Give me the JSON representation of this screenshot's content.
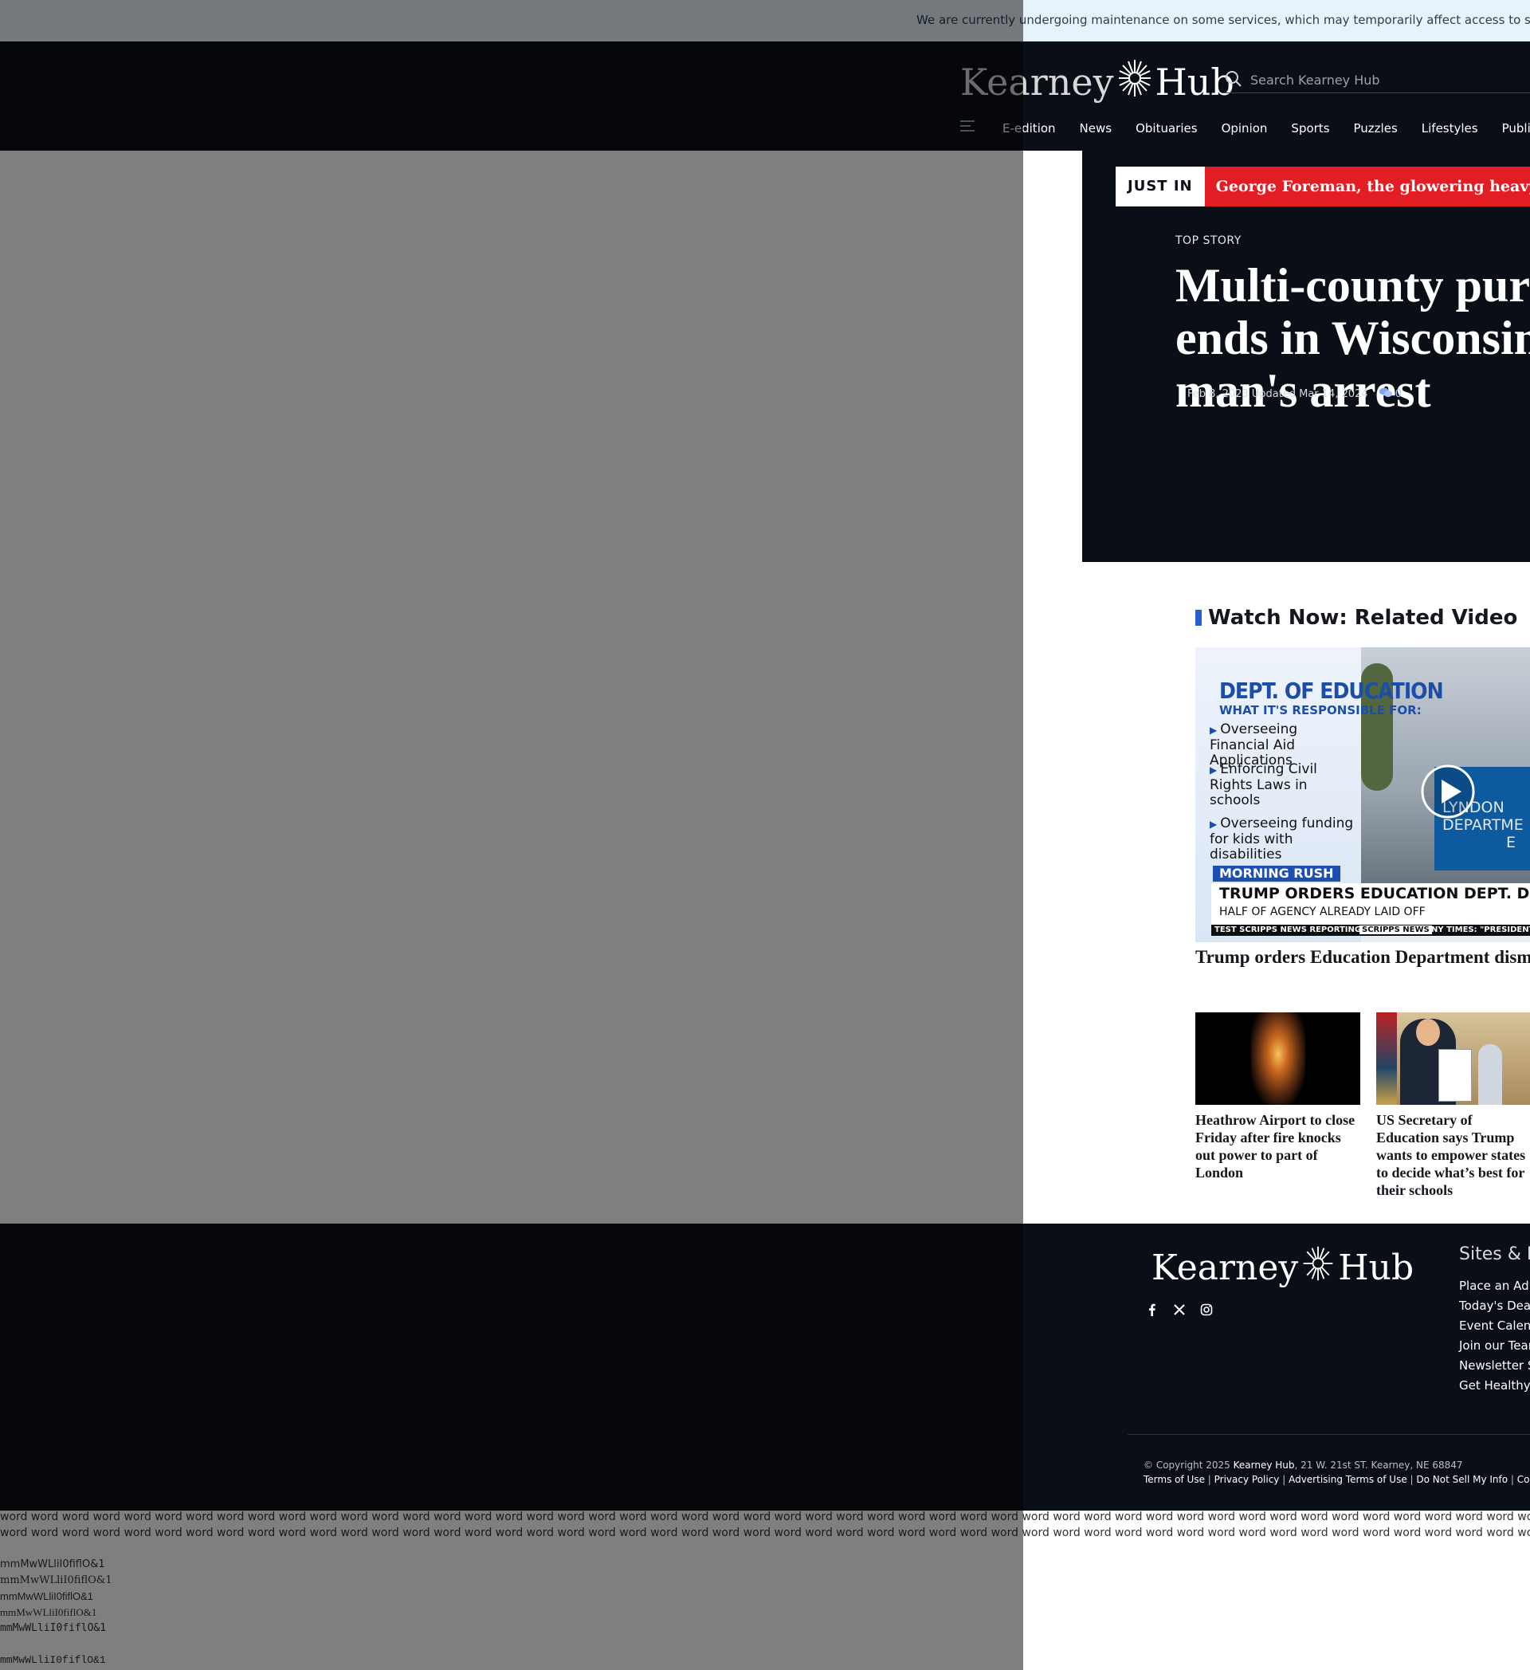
{
  "maintenance": {
    "text": "We are currently undergoing maintenance on some services, which may temporarily affect access to subscriptions"
  },
  "header": {
    "logo": {
      "left": "Kearney",
      "right": "Hub"
    },
    "search": {
      "placeholder": "Search Kearney Hub",
      "value": ""
    },
    "nav": [
      "E-edition",
      "News",
      "Obituaries",
      "Opinion",
      "Sports",
      "Puzzles",
      "Lifestyles",
      "Public Notices"
    ]
  },
  "just_in": {
    "tag": "JUST IN",
    "ticker": "George Foreman, the glowering heavyweight who"
  },
  "hero": {
    "kicker": "TOP STORY",
    "headline": "Multi-county pursuit ends in Wisconsin man's arrest",
    "published": "Feb 8, 2023",
    "updated_label": "Updated",
    "updated": "Mar 14, 2024",
    "comment_count": "0"
  },
  "watch": {
    "title": "Watch Now: Related Video",
    "video": {
      "graphic_title": "DEPT. OF EDUCATION",
      "graphic_sub": "WHAT IT'S RESPONSIBLE FOR:",
      "items": [
        "Overseeing Financial Aid Applications",
        "Enforcing Civil Rights Laws in schools",
        "Overseeing funding for kids with disabilities"
      ],
      "sign_lines": [
        "LYNDON",
        "DEPARTME",
        "E"
      ],
      "show": "MORNING RUSH",
      "lower_third": "TRUMP ORDERS EDUCATION DEPT. DISMANTLED",
      "lower_third_sub": "HALF OF AGENCY ALREADY LAID OFF",
      "ticker_left": "TEST SCRIPPS NEWS REPORTING",
      "ticker_brand": "SCRIPPS NEWS",
      "ticker_right": "NY TIMES: \"PRESIDENT TR"
    },
    "caption": "Trump orders Education Department dismantled"
  },
  "cards": [
    {
      "title": "Heathrow Airport to close Friday after fire knocks out power to part of London"
    },
    {
      "title": "US Secretary of Education says Trump wants to empower states to decide what’s best for their schools"
    }
  ],
  "footer": {
    "logo": {
      "left": "Kearney",
      "right": "Hub"
    },
    "sites_heading": "Sites & Partners",
    "sites": [
      "Place an Ad",
      "Today's Deals",
      "Event Calendar",
      "Join our Team",
      "Newsletter Signup",
      "Get Healthy"
    ],
    "copyright_prefix": "© Copyright 2025",
    "copyright_brand": "Kearney Hub",
    "copyright_address": ", 21 W. 21st ST. Kearney, NE 68847",
    "legal": [
      "Terms of Use",
      "Privacy Policy",
      "Advertising Terms of Use",
      "Do Not Sell My Info",
      "Cookie Preferences"
    ]
  },
  "font_test": {
    "words_line": "word word word word word word word word word word word word word word word word word word word word word word word word word word word word word word word word word word word word word word word word word word word word word word word word word word word word word word word word word word word word word word word word word word word word word word word word word word word word word word word",
    "glyph_lines": [
      "mmMwWLliI0fiflO&1",
      "mmMwWLliI0fiflO&1",
      "mmMwWLliI0fiflO&1",
      "mmMwWLliI0fiflO&1",
      "mmMwWLliI0fiflO&1",
      "mmMwWLliI0fiflO&1"
    ]
  },
  "colors": {
    "header_bg": "#0a0f17",
    "accent_red": "#e21d23",
    "accent_blue": "#2b5bd7",
    "maintenance_bg": "#e6f3fb"
  }
}
